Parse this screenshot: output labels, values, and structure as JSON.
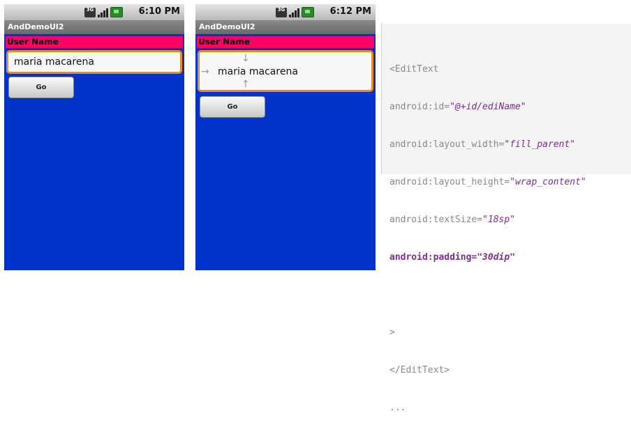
{
  "phone1": {
    "time": "6:10 PM",
    "network": "3G",
    "app_title": "AndDemoUI2",
    "label": "User Name",
    "edit_value": "maria macarena",
    "button": "Go"
  },
  "phone2": {
    "time": "6:12 PM",
    "network": "3G",
    "app_title": "AndDemoUI2",
    "label": "User Name",
    "edit_value": "maria macarena",
    "button": "Go"
  },
  "code": {
    "open_tag": "<EditText",
    "id_attr": "android:id=",
    "id_val": "\"@+id/ediName\"",
    "width_attr": "android:layout_width=",
    "width_val": "\"fill_parent\"",
    "height_attr": "android:layout_height=",
    "height_val": "\"wrap_content\"",
    "size_attr": "android:textSize=",
    "size_val": "\"18sp\"",
    "padding_attr": "android:padding=",
    "padding_val": "\"30dip\"",
    "gt": ">",
    "close_tag": "</EditText>",
    "ellipsis": "..."
  },
  "colors": {
    "screen_bg": "#0033cc",
    "label_bg": "#ff0066",
    "edit_border": "#f08a1c",
    "code_accent": "#7b2e8e"
  }
}
